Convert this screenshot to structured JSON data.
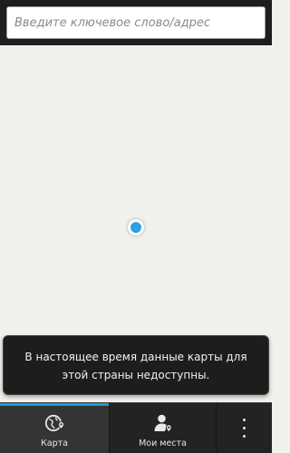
{
  "search": {
    "placeholder": "Введите ключевое слово/адрес"
  },
  "map": {
    "location_marker_icon": "location-dot-icon",
    "marker_color": "#2ea0e8"
  },
  "toast": {
    "message": "В настоящее время данные карты для этой страны недоступны."
  },
  "bottom_bar": {
    "tabs": [
      {
        "label": "Карта",
        "icon": "globe-pin-icon",
        "active": true
      },
      {
        "label": "Мои места",
        "icon": "person-pin-icon",
        "active": false
      }
    ],
    "overflow_icon": "more-vertical-icon",
    "accent_color": "#1b9ad6"
  }
}
